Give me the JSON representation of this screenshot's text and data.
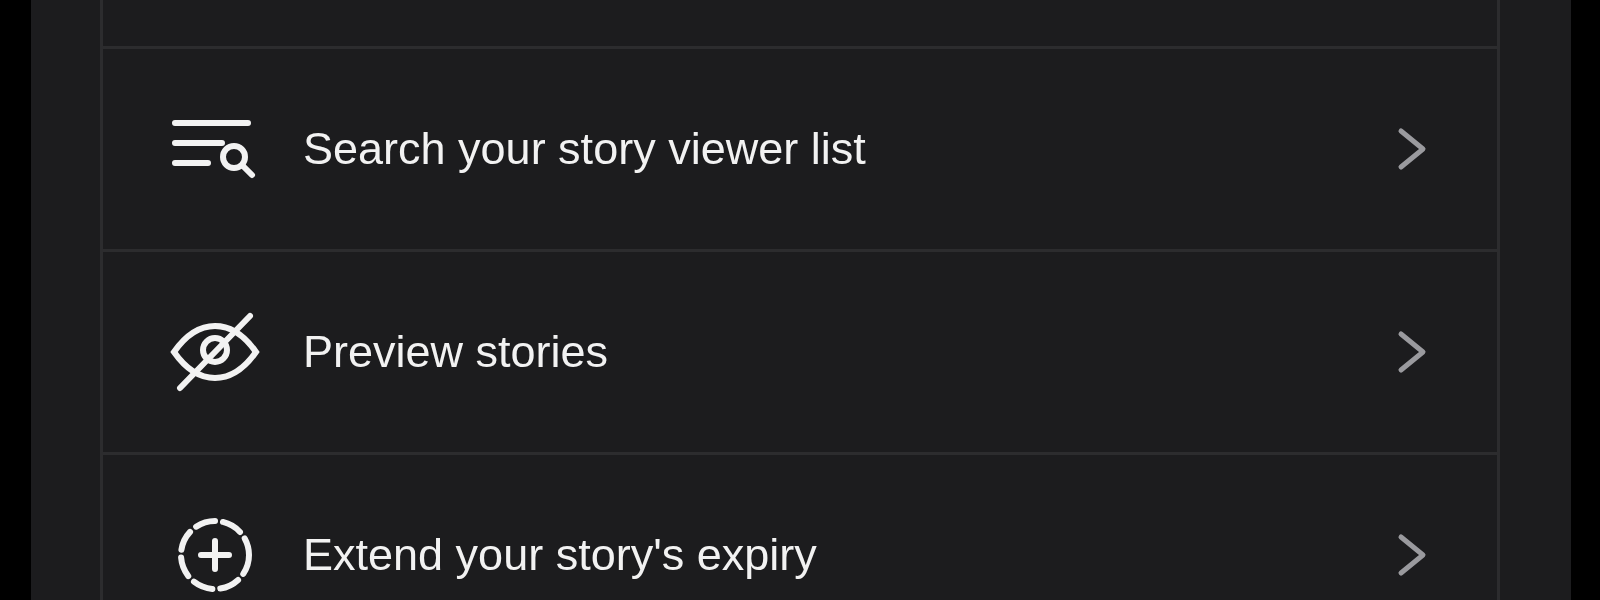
{
  "menu": {
    "items": [
      {
        "kind": "search",
        "label": "Search your story viewer list"
      },
      {
        "kind": "preview",
        "label": "Preview stories"
      },
      {
        "kind": "extend",
        "label": "Extend your story's expiry"
      }
    ]
  }
}
